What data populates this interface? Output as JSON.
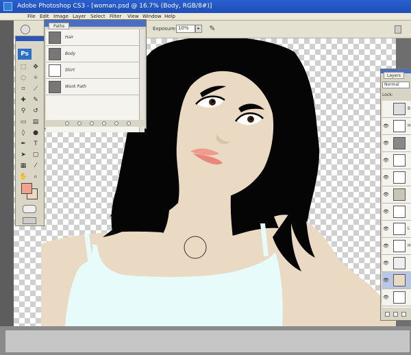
{
  "window": {
    "title": "Adobe Photoshop CS3 - [woman.psd @ 16.7% (Body, RGB/8#)]"
  },
  "menu": [
    "File",
    "Edit",
    "Image",
    "Layer",
    "Select",
    "Filter",
    "View",
    "Window",
    "Help"
  ],
  "options_bar": {
    "exposure_label": "Exposure:",
    "exposure_value": "10%"
  },
  "toolbox": {
    "logo": "Ps",
    "foreground_color": "#f5a18f",
    "background_color": "#efd8c2"
  },
  "paths_panel": {
    "tab": "Paths",
    "items": [
      {
        "name": "Hair"
      },
      {
        "name": "Body"
      },
      {
        "name": "Shirt"
      },
      {
        "name": "Work Path"
      }
    ]
  },
  "layers_panel": {
    "tab": "Layers",
    "blend_mode": "Normal",
    "lock_label": "Lock:",
    "layers": [
      {
        "name": "B",
        "visible": false
      },
      {
        "name": "H",
        "visible": true
      },
      {
        "name": "",
        "visible": true
      },
      {
        "name": "",
        "visible": true
      },
      {
        "name": "",
        "visible": true
      },
      {
        "name": "",
        "visible": true
      },
      {
        "name": "",
        "visible": true
      },
      {
        "name": "L",
        "visible": true
      },
      {
        "name": "H",
        "visible": true
      },
      {
        "name": "",
        "visible": true
      },
      {
        "name": "",
        "visible": true
      },
      {
        "name": "",
        "visible": true
      }
    ]
  },
  "colors": {
    "hair": "#050505",
    "skin": "#ead9c3",
    "lips": "#f09b8e",
    "shirt": "#e6fbfa"
  }
}
